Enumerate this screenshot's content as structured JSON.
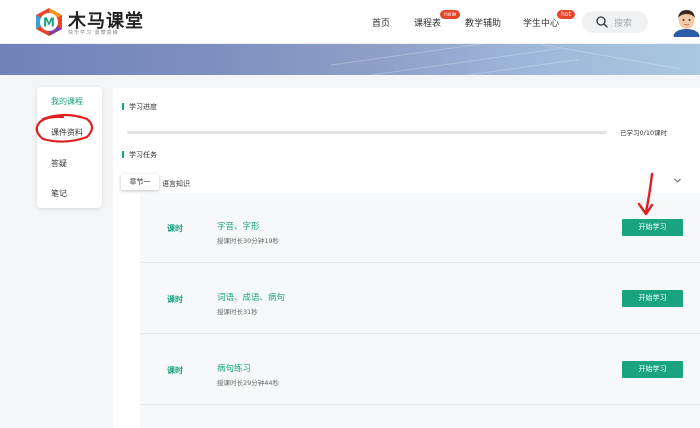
{
  "brand": {
    "title": "木马课堂",
    "slogan": "快乐学习  勇攀高峰",
    "logo_letter": "M",
    "accent": "#19a47f"
  },
  "nav": [
    {
      "label": "首页"
    },
    {
      "label": "课程表",
      "badge": "new"
    },
    {
      "label": "教学辅助"
    },
    {
      "label": "学生中心",
      "badge": "hot"
    }
  ],
  "search": {
    "placeholder": "搜索",
    "icon": "search-icon"
  },
  "sidebar": {
    "items": [
      {
        "label": "我的课程",
        "active": true
      },
      {
        "label": "课件资料",
        "active": false
      },
      {
        "label": "答疑",
        "active": false
      },
      {
        "label": "笔记",
        "active": false
      }
    ]
  },
  "progress": {
    "title": "学习进度",
    "text": "已学习0/10课时",
    "completed": 0,
    "total": 10
  },
  "tasks": {
    "title": "学习任务",
    "chapter_tag": "章节一",
    "chapter_name": "语言知识",
    "lessons": [
      {
        "kind": "课时",
        "title": "字音、字形",
        "duration": "授课时长30分钟19秒",
        "button": "开始学习"
      },
      {
        "kind": "课时",
        "title": "词语、成语、病句",
        "duration": "授课时长31秒",
        "button": "开始学习"
      },
      {
        "kind": "课时",
        "title": "病句练习",
        "duration": "授课时长29分钟44秒",
        "button": "开始学习"
      }
    ]
  },
  "colors": {
    "badge": "#e8452c",
    "annotation": "#e02020"
  }
}
